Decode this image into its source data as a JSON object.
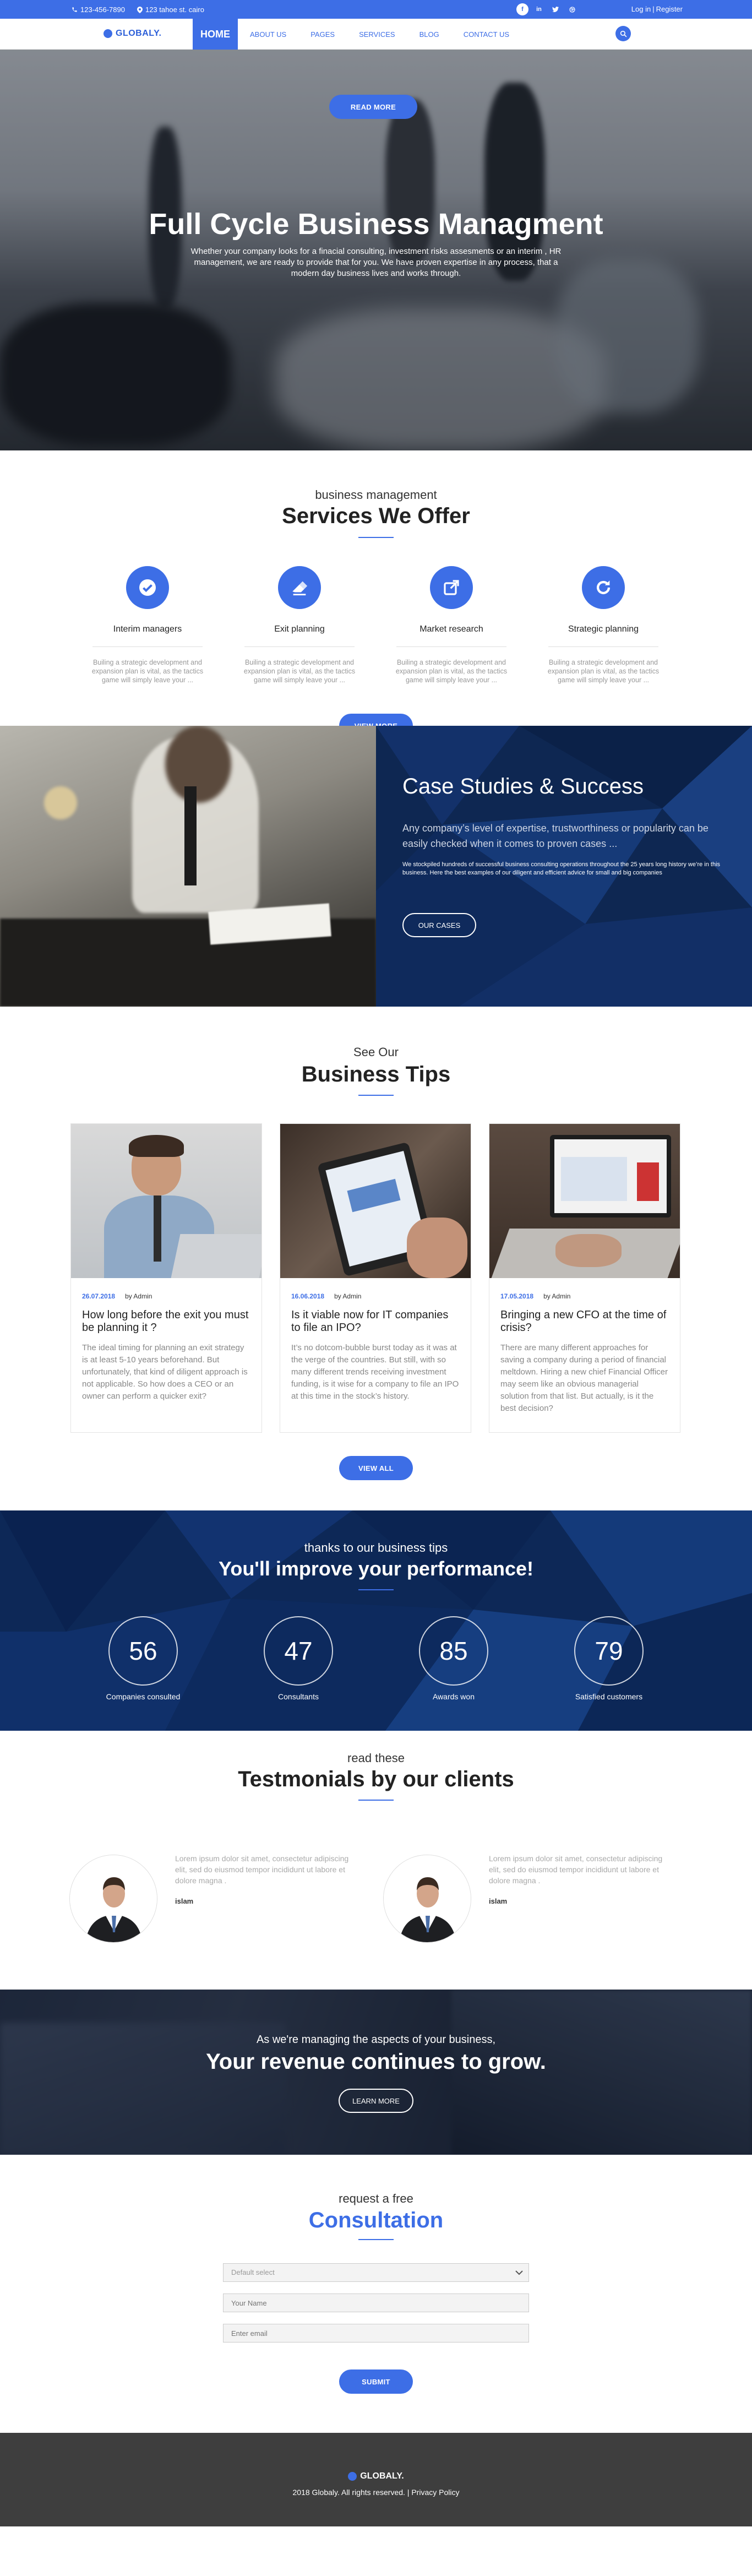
{
  "topbar": {
    "phone": "123-456-7890",
    "address": "123 tahoe st. cairo",
    "auth_login": "Log in",
    "auth_sep": "|",
    "auth_register": "Register",
    "social": [
      "facebook-icon",
      "linkedin-icon",
      "twitter-icon",
      "dribbble-icon"
    ]
  },
  "nav": {
    "logo": "GLOBALY.",
    "items": [
      "HOME",
      "ABOUT US",
      "PAGES",
      "SERVICES",
      "BLOG",
      "CONTACT US"
    ],
    "active": "HOME"
  },
  "hero": {
    "button": "READ MORE",
    "title": "Full Cycle Business Managment",
    "text": "Whether your company looks for a finacial consulting, investment risks assesments or an interim , HR management, we are ready to provide that for you. We have proven expertise in any process, that a modern day business lives and works through."
  },
  "services": {
    "eyebrow": "business management",
    "title": "Services We Offer",
    "items": [
      {
        "icon": "check-circle-icon",
        "title": "Interim managers",
        "text": "Builing a strategic development and expansion plan is vital, as the tactics game will simply leave your ..."
      },
      {
        "icon": "eraser-icon",
        "title": "Exit planning",
        "text": "Builing a strategic development and expansion plan is vital, as the tactics game will simply leave your ..."
      },
      {
        "icon": "external-link-icon",
        "title": "Market research",
        "text": "Builing a strategic development and expansion plan is vital, as the tactics game will simply leave your ..."
      },
      {
        "icon": "refresh-icon",
        "title": "Strategic planning",
        "text": "Builing a strategic development and expansion plan is vital, as the tactics game will simply leave your ..."
      }
    ],
    "button": "VIEW MORE"
  },
  "cases": {
    "title": "Case Studies & Success",
    "lead": "Any company’s level of expertise, trustworthiness or popularity can be easily checked when it comes to proven cases ...",
    "text": "We stockpiled hundreds of successful business consulting operations throughout the 25 years long history we’re in this business. Here the best examples of our diligent and efficient advice for small and big companies",
    "button": "OUR CASES"
  },
  "tips": {
    "eyebrow": "See Our",
    "title": "Business Tips",
    "posts": [
      {
        "date": "26.07.2018",
        "author": "by Admin",
        "title": "How long before the exit you must be planning it ?",
        "text": "The ideal timing for planning an exit strategy is at least 5-10 years beforehand. But unfortunately, that kind of diligent approach is not applicable. So how does a CEO or an owner can perform a quicker exit?"
      },
      {
        "date": "16.06.2018",
        "author": "by Admin",
        "title": "Is it viable now for IT companies to file an IPO?",
        "text": "It’s no dotcom-bubble burst today as it was at the verge of the countries. But still, with so many different trends receiving investment funding, is it wise for a company to file an IPO at this time in the stock’s history."
      },
      {
        "date": "17.05.2018",
        "author": "by Admin",
        "title": "Bringing a new CFO at the time of crisis?",
        "text": "There are many different approaches for saving a company during a period of financial meltdown. Hiring a new chief Financial Officer may seem like an obvious managerial solution from that list. But actually, is it the best decision?"
      }
    ],
    "button": "VIEW ALL"
  },
  "stats": {
    "eyebrow": "thanks to our business tips",
    "title": "You'll improve your performance!",
    "counters": [
      {
        "value": "56",
        "label": "Companies consulted"
      },
      {
        "value": "47",
        "label": "Consultants"
      },
      {
        "value": "85",
        "label": "Awards won"
      },
      {
        "value": "79",
        "label": "Satisfied customers"
      }
    ]
  },
  "testimonials": {
    "eyebrow": "read these",
    "title": "Testmonials by our clients",
    "items": [
      {
        "quote": "Lorem ipsum dolor sit amet, consectetur adipiscing elit, sed do eiusmod tempor incididunt ut labore et dolore magna .",
        "name": "islam"
      },
      {
        "quote": "Lorem ipsum dolor sit amet, consectetur adipiscing elit, sed do eiusmod tempor incididunt ut labore et dolore magna .",
        "name": "islam"
      }
    ]
  },
  "revenue": {
    "eyebrow": "As we're managing the aspects of your business,",
    "title": "Your revenue continues to grow.",
    "button": "LEARN MORE"
  },
  "consultation": {
    "eyebrow": "request a free",
    "title": "Consultation",
    "select_value": "Default select",
    "name_placeholder": "Your Name",
    "email_placeholder": "Enter email",
    "button": "SUBMIT"
  },
  "footer": {
    "logo": "GLOBALY.",
    "copyright": "2018 Globaly. All rights reserved. | Privacy Policy"
  },
  "colors": {
    "accent": "#3d6ee6",
    "navy": "#0d2857",
    "footer": "#3e3e3e"
  }
}
